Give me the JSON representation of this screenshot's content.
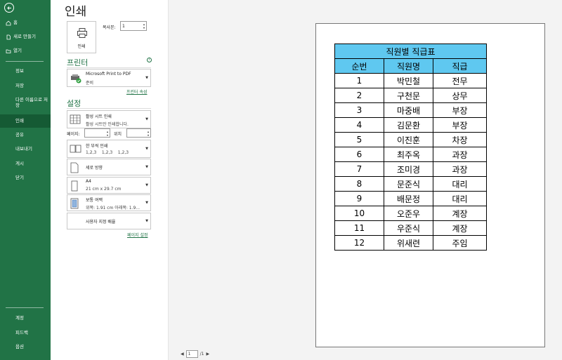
{
  "sidebar": {
    "top_items": [
      {
        "label": "홈",
        "icon": "home-icon"
      },
      {
        "label": "새로 만들기",
        "icon": "new-file-icon"
      },
      {
        "label": "열기",
        "icon": "folder-open-icon"
      }
    ],
    "sub_items": [
      "정보",
      "저장",
      "다른 이름으로 저장",
      "인쇄",
      "공유",
      "내보내기",
      "게시",
      "닫기"
    ],
    "active": "인쇄",
    "bottom_items": [
      "계정",
      "피드백",
      "옵션"
    ]
  },
  "page": {
    "title": "인쇄"
  },
  "print": {
    "button_label": "인쇄",
    "copies_label": "복사본:",
    "copies_value": "1"
  },
  "printer": {
    "section_title": "프린터",
    "name": "Microsoft Print to PDF",
    "status": "준비",
    "properties_link": "프린터 속성"
  },
  "settings": {
    "section_title": "설정",
    "what": {
      "line1": "활성 시트 인쇄",
      "line2": "활성 시트만 인쇄합니다."
    },
    "pages_label": "페이지:",
    "pages_to_label": "위치",
    "collate": {
      "line1": "한 부씩 인쇄",
      "line2": "1,2,3    1,2,3    1,2,3"
    },
    "orientation": {
      "line1": "세로 방향"
    },
    "paper": {
      "line1": "A4",
      "line2": "21 cm x 29.7 cm"
    },
    "margins": {
      "line1": "보통 여백",
      "line2": "위쪽: 1.91 cm 아래쪽: 1.9..."
    },
    "scaling": {
      "line1": "사용자 지정 배율"
    },
    "page_setup_link": "페이지 설정"
  },
  "preview": {
    "sheet_title": "직원별 직급표",
    "headers": [
      "순번",
      "직원명",
      "직급"
    ],
    "rows": [
      [
        "1",
        "박민철",
        "전무"
      ],
      [
        "2",
        "구천문",
        "상무"
      ],
      [
        "3",
        "마중배",
        "부장"
      ],
      [
        "4",
        "김문환",
        "부장"
      ],
      [
        "5",
        "이진훈",
        "차장"
      ],
      [
        "6",
        "최주옥",
        "과장"
      ],
      [
        "7",
        "조미경",
        "과장"
      ],
      [
        "8",
        "문준식",
        "대리"
      ],
      [
        "9",
        "배문정",
        "대리"
      ],
      [
        "10",
        "오준우",
        "계장"
      ],
      [
        "11",
        "우준식",
        "계장"
      ],
      [
        "12",
        "위새련",
        "주임"
      ]
    ],
    "header_color": "#5fc8f0",
    "page_current": "1",
    "page_total": "/1"
  },
  "colors": {
    "accent": "#217346",
    "sidebar_active": "#155a34"
  }
}
